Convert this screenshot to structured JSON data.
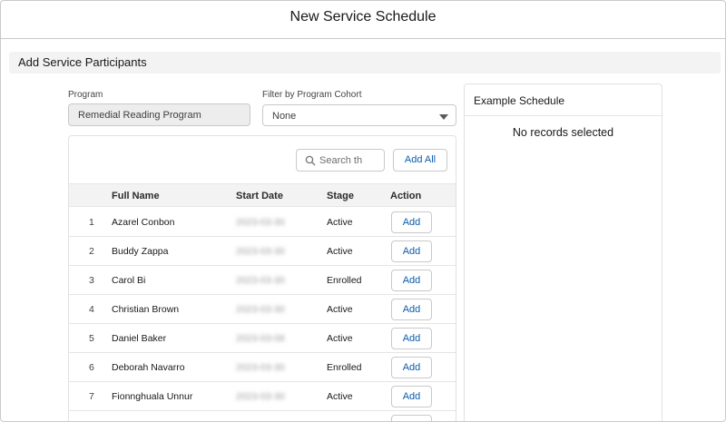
{
  "modal": {
    "title": "New Service Schedule"
  },
  "section": {
    "title": "Add Service Participants"
  },
  "program": {
    "label": "Program",
    "value": "Remedial Reading Program"
  },
  "cohort_filter": {
    "label": "Filter by Program Cohort",
    "value": "None"
  },
  "search": {
    "placeholder": "Search th"
  },
  "add_all_label": "Add All",
  "table": {
    "headers": [
      "Full Name",
      "Start Date",
      "Stage",
      "Action"
    ],
    "rows": [
      {
        "num": "1",
        "name": "Azarel Conbon",
        "start_date": "2023-03-30",
        "stage": "Active",
        "action": "Add"
      },
      {
        "num": "2",
        "name": "Buddy Zappa",
        "start_date": "2023-03-30",
        "stage": "Active",
        "action": "Add"
      },
      {
        "num": "3",
        "name": "Carol Bi",
        "start_date": "2023-03-30",
        "stage": "Enrolled",
        "action": "Add"
      },
      {
        "num": "4",
        "name": "Christian Brown",
        "start_date": "2023-03-30",
        "stage": "Active",
        "action": "Add"
      },
      {
        "num": "5",
        "name": "Daniel Baker",
        "start_date": "2023-03-08",
        "stage": "Active",
        "action": "Add"
      },
      {
        "num": "6",
        "name": "Deborah Navarro",
        "start_date": "2023-03-30",
        "stage": "Enrolled",
        "action": "Add"
      },
      {
        "num": "7",
        "name": "Fionnghuala Unnur",
        "start_date": "2023-03-30",
        "stage": "Active",
        "action": "Add"
      }
    ]
  },
  "example_schedule": {
    "title": "Example Schedule",
    "empty_message": "No records selected"
  },
  "icons": {
    "search": "search-icon",
    "dropdown": "chevron-down-icon"
  },
  "colors": {
    "link": "#0b5cab",
    "header_bg": "#f3f3f3",
    "border": "#c9c9c9"
  }
}
